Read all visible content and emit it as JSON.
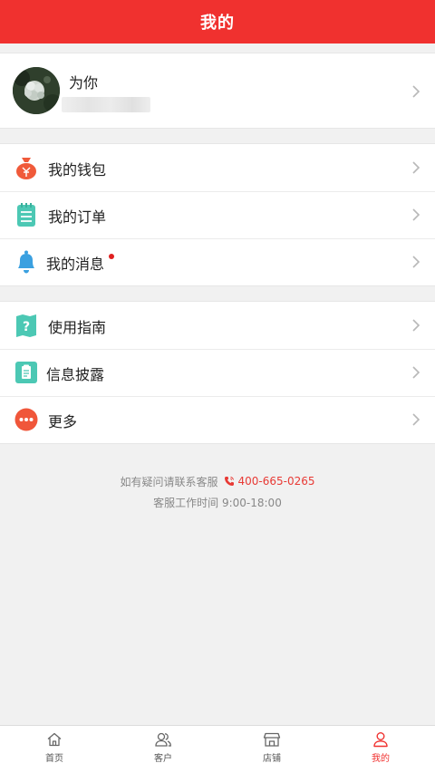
{
  "header": {
    "title": "我的"
  },
  "profile": {
    "nickname": "为你"
  },
  "menu_group_1": [
    {
      "label": "我的钱包",
      "icon": "wallet-bag-icon",
      "color": "#f05a3a"
    },
    {
      "label": "我的订单",
      "icon": "order-list-icon",
      "color": "#4cc8b4"
    },
    {
      "label": "我的消息",
      "icon": "bell-icon",
      "color": "#3aa0e0",
      "has_unread": true
    }
  ],
  "menu_group_2": [
    {
      "label": "使用指南",
      "icon": "guide-map-icon",
      "color": "#4cc8b4"
    },
    {
      "label": "信息披露",
      "icon": "document-icon",
      "color": "#4cc8b4"
    },
    {
      "label": "更多",
      "icon": "more-dots-icon",
      "color": "#f0563a"
    }
  ],
  "contact": {
    "prompt": "如有疑问请联系客服",
    "phone": "400-665-0265",
    "hours": "客服工作时间 9:00-18:00"
  },
  "tabbar": [
    {
      "label": "首页",
      "icon": "home-icon",
      "active": false
    },
    {
      "label": "客户",
      "icon": "customers-icon",
      "active": false
    },
    {
      "label": "店铺",
      "icon": "store-icon",
      "active": false
    },
    {
      "label": "我的",
      "icon": "profile-icon",
      "active": true
    }
  ],
  "colors": {
    "brand_red": "#f0312f",
    "background": "#f1f1f1"
  }
}
